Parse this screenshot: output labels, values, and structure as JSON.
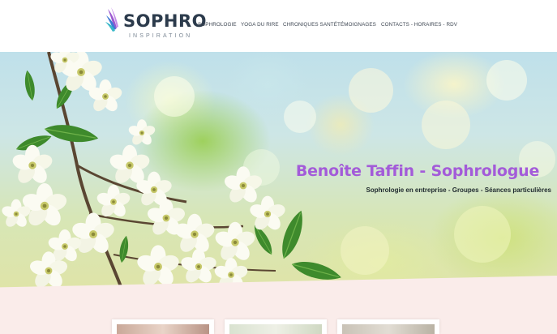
{
  "header": {
    "logo": {
      "word": "SOPHRO",
      "tagline": "INSPIRATION"
    },
    "nav": [
      {
        "label": "SOPHROLOGIE"
      },
      {
        "label": "YOGA DU RIRE"
      },
      {
        "label": "CHRONIQUES SANTÉ"
      },
      {
        "label": "TÉMOIGNAGES"
      },
      {
        "label": "CONTACTS - HORAIRES - RDV"
      }
    ]
  },
  "hero": {
    "title": "Benoîte Taffin - Sophrologue",
    "subtitle": "Sophrologie en entreprise - Groupes - Séances particulières",
    "image": "cherry-blossom-branch"
  },
  "cards": [
    {
      "image": "card-image-1"
    },
    {
      "image": "card-image-2"
    },
    {
      "image": "card-image-3"
    }
  ],
  "colors": {
    "title_purple": "#a35bd9",
    "logo_dark": "#2c3b4c",
    "pink_band": "#faecea",
    "logo_purple": "#9b59d0",
    "logo_blue": "#3f7bd6",
    "logo_teal": "#39b8c8"
  }
}
